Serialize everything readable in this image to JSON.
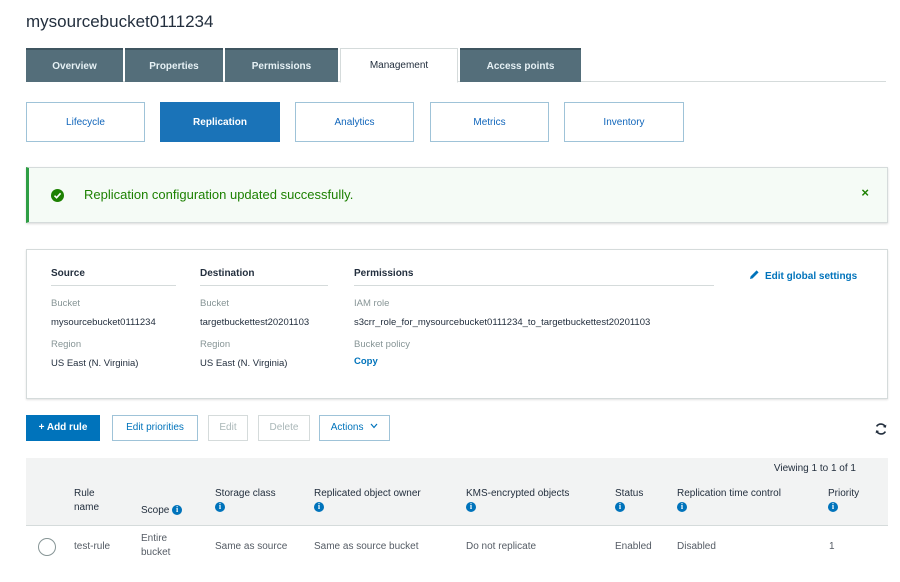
{
  "bucket_name": "mysourcebucket0111234",
  "main_tabs": [
    "Overview",
    "Properties",
    "Permissions",
    "Management",
    "Access points"
  ],
  "active_main_tab": "Management",
  "sub_tabs": [
    "Lifecycle",
    "Replication",
    "Analytics",
    "Metrics",
    "Inventory"
  ],
  "active_sub_tab": "Replication",
  "alert": {
    "message": "Replication configuration updated successfully.",
    "close_symbol": "×",
    "icon": "check-circle-icon",
    "color": "#1d8102"
  },
  "summary": {
    "source": {
      "heading": "Source",
      "bucket_label": "Bucket",
      "bucket": "mysourcebucket0111234",
      "region_label": "Region",
      "region": "US East (N. Virginia)"
    },
    "destination": {
      "heading": "Destination",
      "bucket_label": "Bucket",
      "bucket": "targetbuckettest20201103",
      "region_label": "Region",
      "region": "US East (N. Virginia)"
    },
    "permissions": {
      "heading": "Permissions",
      "iam_label": "IAM role",
      "iam_role": "s3crr_role_for_mysourcebucket0111234_to_targetbuckettest20201103",
      "policy_label": "Bucket policy",
      "policy_link": "Copy"
    },
    "edit_global": "Edit global settings"
  },
  "toolbar": {
    "add_rule": "+ Add rule",
    "edit_priorities": "Edit priorities",
    "edit": "Edit",
    "delete": "Delete",
    "actions": "Actions"
  },
  "table": {
    "viewing": "Viewing 1 to 1 of 1",
    "headers": {
      "rule_name": [
        "Rule",
        "name"
      ],
      "scope": "Scope",
      "storage_class": "Storage class",
      "owner": "Replicated object owner",
      "kms": "KMS-encrypted objects",
      "status": "Status",
      "rtc": "Replication time control",
      "priority": "Priority"
    },
    "rows": [
      {
        "rule_name": "test-rule",
        "scope": [
          "Entire",
          "bucket"
        ],
        "storage_class": "Same as source",
        "owner": "Same as source bucket",
        "kms": "Do not replicate",
        "status": "Enabled",
        "rtc": "Disabled",
        "priority": "1"
      }
    ]
  },
  "colors": {
    "accent": "#0073bb",
    "tab_bg": "#546e7a",
    "success": "#1d8102"
  }
}
